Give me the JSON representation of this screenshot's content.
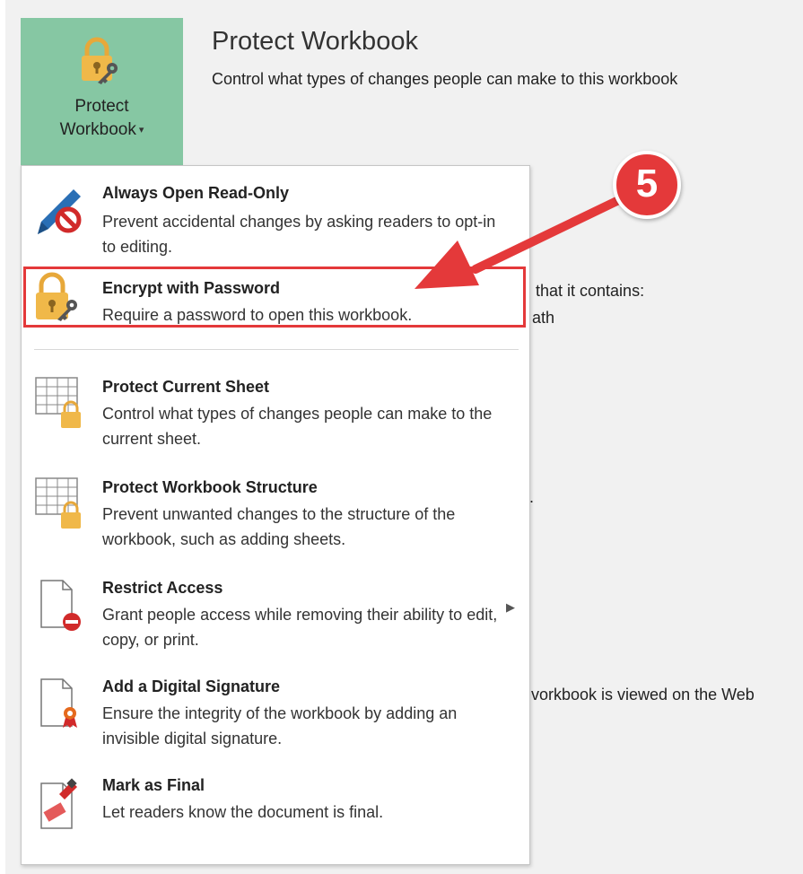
{
  "section": {
    "button_line1": "Protect",
    "button_line2": "Workbook",
    "title": "Protect Workbook",
    "description": "Control what types of changes people can make to this workbook"
  },
  "background_fragments": {
    "contains": "that it contains:",
    "path": "ath",
    "period": ".",
    "web": "vorkbook is viewed on the Web"
  },
  "menu": {
    "items": [
      {
        "title": "Always Open Read-Only",
        "desc": "Prevent accidental changes by asking readers to opt-in to editing."
      },
      {
        "title": "Encrypt with Password",
        "desc": "Require a password to open this workbook."
      },
      {
        "title": "Protect Current Sheet",
        "desc": "Control what types of changes people can make to the current sheet."
      },
      {
        "title": "Protect Workbook Structure",
        "desc": "Prevent unwanted changes to the structure of the workbook, such as adding sheets."
      },
      {
        "title": "Restrict Access",
        "desc": "Grant people access while removing their ability to edit, copy, or print."
      },
      {
        "title": "Add a Digital Signature",
        "desc": "Ensure the integrity of the workbook by adding an invisible digital signature."
      },
      {
        "title": "Mark as Final",
        "desc": "Let readers know the document is final."
      }
    ]
  },
  "annotation": {
    "step": "5"
  },
  "colors": {
    "button_bg": "#86c7a3",
    "highlight": "#e4393a",
    "lock": "#f0b849"
  }
}
